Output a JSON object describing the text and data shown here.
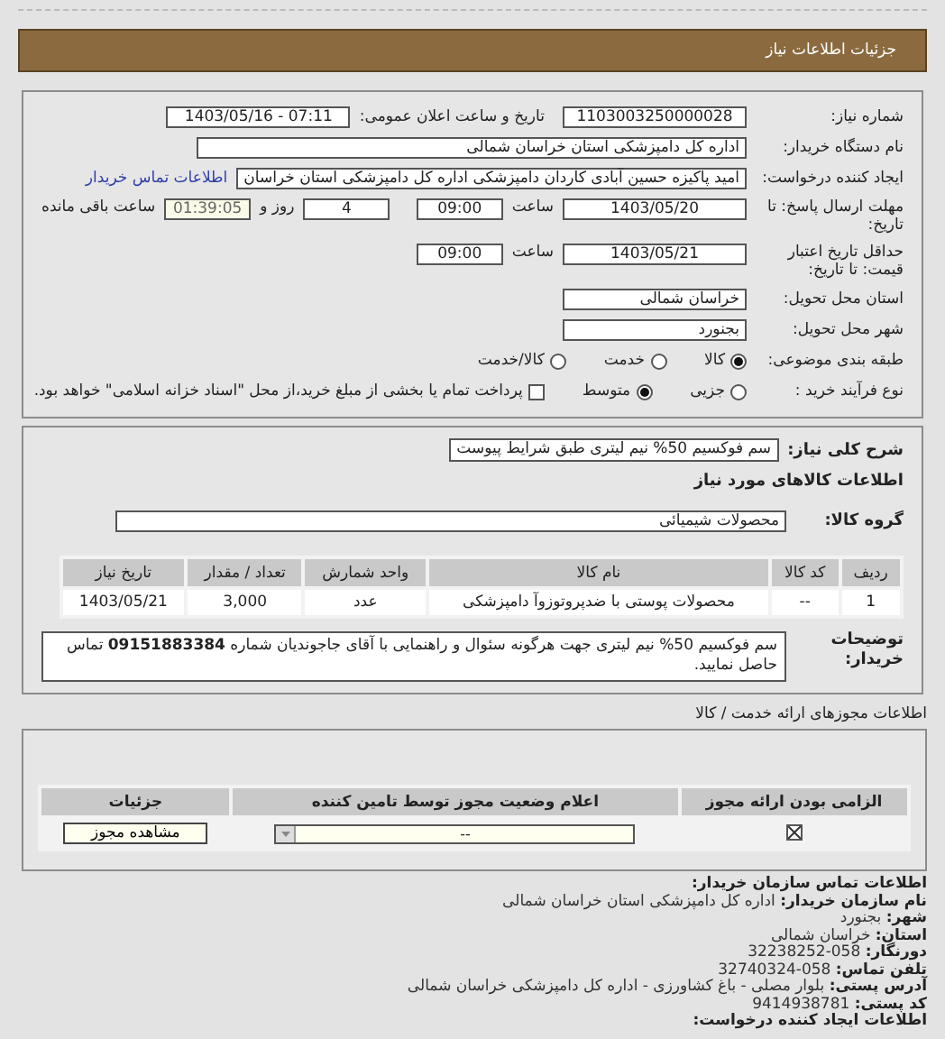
{
  "header": {
    "title": "جزئیات اطلاعات نیاز"
  },
  "details": {
    "need_number": {
      "label": "شماره نیاز:",
      "value": "1103003250000028"
    },
    "announce": {
      "label": "تاریخ و ساعت اعلان عمومی:",
      "value": "1403/05/16 - 07:11"
    },
    "buyer": {
      "label": "نام دستگاه خریدار:",
      "value": "اداره کل دامپزشکی استان خراسان شمالی"
    },
    "requester": {
      "label": "ایجاد کننده درخواست:",
      "value": "امید پاکیزه حسین آبادی کاردان دامپزشکی اداره کل دامپزشکی استان خراسان",
      "link": "اطلاعات تماس خریدار"
    },
    "deadline": {
      "label": "مهلت ارسال پاسخ: تا تاریخ:",
      "date": "1403/05/20",
      "time_label": "ساعت",
      "time": "09:00",
      "days": "4",
      "days_label": "روز و",
      "remaining": "01:39:05",
      "remaining_label": "ساعت باقی مانده"
    },
    "validity": {
      "label": "حداقل تاریخ اعتبار قیمت: تا تاریخ:",
      "date": "1403/05/21",
      "time_label": "ساعت",
      "time": "09:00"
    },
    "province": {
      "label": "استان محل تحویل:",
      "value": "خراسان شمالی"
    },
    "city": {
      "label": "شهر محل تحویل:",
      "value": "بجنورد"
    },
    "category": {
      "label": "طبقه بندی موضوعی:",
      "options": [
        {
          "label": "کالا",
          "selected": true
        },
        {
          "label": "خدمت",
          "selected": false
        },
        {
          "label": "کالا/خدمت",
          "selected": false
        }
      ]
    },
    "process": {
      "label": "نوع فرآیند خرید :",
      "options": [
        {
          "label": "جزیی",
          "selected": false
        },
        {
          "label": "متوسط",
          "selected": true
        }
      ],
      "payment": {
        "checked": false,
        "label": "پرداخت تمام یا بخشی از مبلغ خرید،از محل \"اسناد خزانه اسلامی\" خواهد بود."
      }
    }
  },
  "need": {
    "summary_label": "شرح کلی نیاز:",
    "summary": "سم فوکسیم 50% نیم لیتری طبق شرایط پیوست",
    "goods_heading": "اطلاعات کالاهای مورد نیاز",
    "group_label": "گروه کالا:",
    "group": "محصولات شیمیائی",
    "table": {
      "columns": [
        "ردیف",
        "کد کالا",
        "نام کالا",
        "واحد شمارش",
        "تعداد / مقدار",
        "تاریخ نیاز"
      ],
      "rows": [
        [
          "1",
          "--",
          "محصولات پوستی با ضدپروتوزوآ دامپزشکی",
          "عدد",
          "3,000",
          "1403/05/21"
        ]
      ]
    },
    "notes_label": "توضیحات خریدار:",
    "notes": "سم فوکسیم 50% نیم لیتری جهت هرگونه سئوال و راهنمایی با آقای جاجوندیان شماره **09151883384** تماس حاصل نمایید."
  },
  "licenses": {
    "heading": "اطلاعات مجوزهای ارائه خدمت / کالا",
    "columns": [
      "الزامی بودن ارائه مجوز",
      "اعلام وضعیت مجوز توسط تامین کننده",
      "جزئیات"
    ],
    "rows": [
      {
        "required": true,
        "status": "--",
        "button": "مشاهده مجوز"
      }
    ]
  },
  "contact": {
    "heading": "اطلاعات تماس سازمان خریدار:",
    "lines": [
      {
        "label": "نام سازمان خریدار:",
        "value": "اداره کل دامپزشکی استان خراسان شمالی"
      },
      {
        "label": "شهر:",
        "value": "بجنورد"
      },
      {
        "label": "استان:",
        "value": "خراسان شمالی"
      },
      {
        "label": "دورنگار:",
        "value": "32238252-058"
      },
      {
        "label": "تلفن تماس:",
        "value": "32740324-058"
      },
      {
        "label": "آدرس پستی:",
        "value": "بلوار مصلی - باغ کشاورزی - اداره کل دامپزشکی خراسان شمالی"
      },
      {
        "label": "کد پستی:",
        "value": "9414938781"
      }
    ],
    "next_heading": "اطلاعات ایجاد کننده درخواست:"
  }
}
